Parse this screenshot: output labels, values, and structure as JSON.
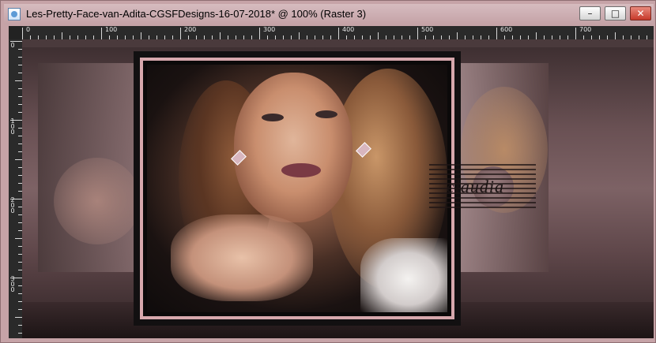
{
  "window": {
    "title": "Les-Pretty-Face-van-Adita-CGSFDesigns-16-07-2018* @ 100% (Raster 3)",
    "controls": {
      "minimize": "–",
      "maximize": "□",
      "close": "✕"
    }
  },
  "ruler": {
    "top_labels": [
      "0",
      "100",
      "200",
      "300",
      "400",
      "500",
      "600",
      "700"
    ],
    "left_labels": [
      "0",
      "100",
      "200",
      "300"
    ]
  },
  "canvas": {
    "watermark_text": "claudia"
  },
  "icons": {
    "app": "document-icon",
    "minimize": "minimize-icon",
    "maximize": "maximize-icon",
    "close": "close-icon"
  },
  "colors": {
    "window_bg": "#c6a3a7",
    "ruler_bg": "#2a2a2a",
    "frame_pink": "#d7a8ad"
  }
}
